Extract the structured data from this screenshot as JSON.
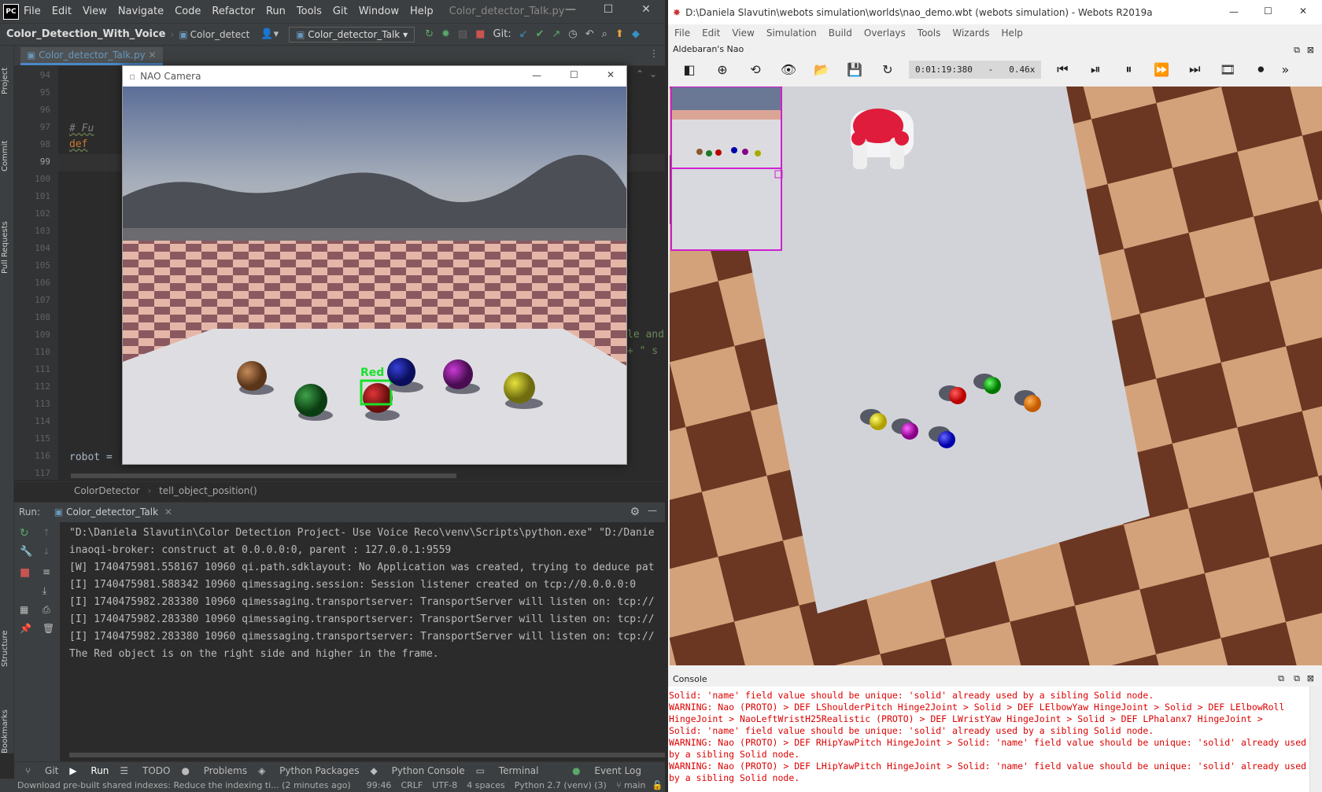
{
  "pycharm": {
    "logo": "PC",
    "menu": [
      "File",
      "Edit",
      "View",
      "Navigate",
      "Code",
      "Refactor",
      "Run",
      "Tools",
      "Git",
      "Window",
      "Help"
    ],
    "window_title": "Color_detector_Talk.py",
    "project": "Color_Detection_With_Voice",
    "breadcrumb_file": "Color_detect",
    "run_config": "Color_detector_Talk",
    "git_label": "Git:",
    "side_tabs": [
      "Project",
      "Commit",
      "Pull Requests",
      "Structure",
      "Bookmarks"
    ],
    "file_tab": "Color_detector_Talk.py",
    "line_numbers": [
      "94",
      "95",
      "96",
      "97",
      "98",
      "99",
      "100",
      "101",
      "102",
      "103",
      "104",
      "105",
      "106",
      "107",
      "108",
      "109",
      "110",
      "111",
      "112",
      "113",
      "114",
      "115",
      "116",
      "117"
    ],
    "code_comment": "# Fu",
    "code_def": "def",
    "code_robot": "robot = ",
    "code_frag1": "le and",
    "code_frag2": "+ \" s",
    "breadcrumb": [
      "ColorDetector",
      "tell_object_position()"
    ],
    "run_label": "Run:",
    "run_tab": "Color_detector_Talk",
    "output_lines": [
      "\"D:\\Daniela Slavutin\\Color Detection Project- Use Voice Reco\\venv\\Scripts\\python.exe\" \"D:/Danie",
      "inaoqi-broker: construct at 0.0.0.0:0, parent : 127.0.0.1:9559",
      "[W] 1740475981.558167 10960 qi.path.sdklayout: No Application was created, trying to deduce pat",
      "[I] 1740475981.588342 10960 qimessaging.session: Session listener created on tcp://0.0.0.0:0",
      "[I] 1740475982.283380 10960 qimessaging.transportserver: TransportServer will listen on: tcp://",
      "[I] 1740475982.283380 10960 qimessaging.transportserver: TransportServer will listen on: tcp://",
      "[I] 1740475982.283380 10960 qimessaging.transportserver: TransportServer will listen on: tcp://",
      "The Red object is on the right side and higher in the frame."
    ],
    "bottom_tabs": [
      "Git",
      "Run",
      "TODO",
      "Problems",
      "Python Packages",
      "Python Console",
      "Terminal",
      "Event Log"
    ],
    "status_message": "Download pre-built shared indexes: Reduce the indexing ti... (2 minutes ago)",
    "status_items": [
      "99:46",
      "CRLF",
      "UTF-8",
      "4 spaces",
      "Python 2.7 (venv) (3)",
      "main"
    ]
  },
  "camera": {
    "title": "NAO Camera",
    "detected_label": "Red"
  },
  "webots": {
    "title": "D:\\Daniela Slavutin\\webots simulation\\worlds\\nao_demo.wbt (webots simulation) - Webots R2019a",
    "menu": [
      "File",
      "Edit",
      "View",
      "Simulation",
      "Build",
      "Overlays",
      "Tools",
      "Wizards",
      "Help"
    ],
    "view_label": "Aldebaran's Nao",
    "time": "0:01:19:380",
    "speed_sep": "-",
    "speed": "0.46x",
    "console_title": "Console",
    "console_lines": [
      "Solid: 'name' field value should be unique: 'solid' already used by a sibling Solid node.",
      "WARNING: Nao (PROTO) > DEF LShoulderPitch Hinge2Joint > Solid > DEF LElbowYaw HingeJoint > Solid > DEF LElbowRoll HingeJoint > NaoLeftWristH25Realistic (PROTO) > DEF LWristYaw HingeJoint > Solid > DEF LPhalanx7 HingeJoint >",
      "Solid: 'name' field value should be unique: 'solid' already used by a sibling Solid node.",
      "WARNING: Nao (PROTO) > DEF RHipYawPitch HingeJoint > Solid: 'name' field value should be unique: 'solid' already used by a sibling Solid node.",
      "WARNING: Nao (PROTO) > DEF LHipYawPitch HingeJoint > Solid: 'name' field value should be unique: 'solid' already used by a sibling Solid node."
    ]
  }
}
